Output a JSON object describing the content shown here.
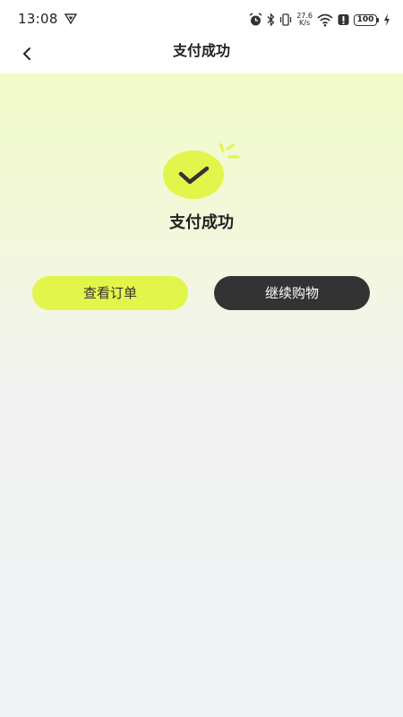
{
  "status_bar": {
    "time": "13:08",
    "network_speed_value": "27.6",
    "network_speed_unit": "K/s",
    "battery_level": "100"
  },
  "nav": {
    "title": "支付成功"
  },
  "result": {
    "title": "支付成功"
  },
  "actions": {
    "view_order_label": "查看订单",
    "continue_shopping_label": "继续购物"
  },
  "colors": {
    "accent": "#e2f54a",
    "dark_button": "#333333"
  }
}
